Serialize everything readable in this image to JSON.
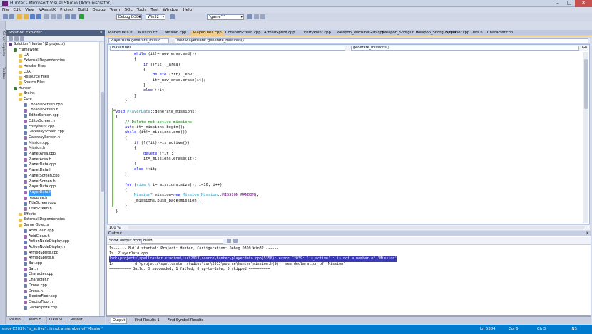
{
  "window": {
    "title": "Hunter - Microsoft Visual Studio (Administrator)",
    "min": "–",
    "max": "□",
    "close": "✕"
  },
  "menu": [
    "File",
    "Edit",
    "View",
    "VAssistX",
    "Project",
    "Build",
    "Debug",
    "Team",
    "SQL",
    "Tools",
    "Test",
    "Window",
    "Help"
  ],
  "menu_display": [
    "File",
    "Edit",
    "View",
    "VAssistX",
    "Project",
    "Build",
    "Debug",
    "TEAM",
    "SQL",
    "Tools",
    "Test",
    "Window",
    "Help"
  ],
  "toolbar": {
    "config": "Debug D3D9",
    "platform": "Win32",
    "find": "\"game\",\""
  },
  "solution_explorer": {
    "title": "Solution Explorer",
    "items": [
      {
        "label": "Solution 'Hunter' (2 projects)",
        "depth": 0,
        "type": "sol"
      },
      {
        "label": "Framework",
        "depth": 1,
        "type": "proj"
      },
      {
        "label": "DX",
        "depth": 2,
        "type": "folder"
      },
      {
        "label": "External Dependencies",
        "depth": 2,
        "type": "folder"
      },
      {
        "label": "Header Files",
        "depth": 2,
        "type": "folder"
      },
      {
        "label": "LUA",
        "depth": 2,
        "type": "folder"
      },
      {
        "label": "Resource Files",
        "depth": 2,
        "type": "folder"
      },
      {
        "label": "Source Files",
        "depth": 2,
        "type": "folder"
      },
      {
        "label": "Hunter",
        "depth": 1,
        "type": "proj"
      },
      {
        "label": "Brains",
        "depth": 2,
        "type": "folder"
      },
      {
        "label": "Core",
        "depth": 2,
        "type": "folder"
      },
      {
        "label": "ConsoleScreen.cpp",
        "depth": 3,
        "type": "cpp"
      },
      {
        "label": "ConsoleScreen.h",
        "depth": 3,
        "type": "h"
      },
      {
        "label": "EditorScreen.cpp",
        "depth": 3,
        "type": "cpp"
      },
      {
        "label": "EditorScreen.h",
        "depth": 3,
        "type": "h"
      },
      {
        "label": "EntryPoint.cpp",
        "depth": 3,
        "type": "cpp"
      },
      {
        "label": "GatewayScreen.cpp",
        "depth": 3,
        "type": "cpp"
      },
      {
        "label": "GatewayScreen.h",
        "depth": 3,
        "type": "h"
      },
      {
        "label": "Mission.cpp",
        "depth": 3,
        "type": "cpp"
      },
      {
        "label": "Mission.h",
        "depth": 3,
        "type": "h"
      },
      {
        "label": "PlanetArea.cpp",
        "depth": 3,
        "type": "cpp"
      },
      {
        "label": "PlanetArea.h",
        "depth": 3,
        "type": "h"
      },
      {
        "label": "PlanetData.cpp",
        "depth": 3,
        "type": "cpp"
      },
      {
        "label": "PlanetData.h",
        "depth": 3,
        "type": "h"
      },
      {
        "label": "PlanetScreen.cpp",
        "depth": 3,
        "type": "cpp"
      },
      {
        "label": "PlanetScreen.h",
        "depth": 3,
        "type": "h"
      },
      {
        "label": "PlayerData.cpp",
        "depth": 3,
        "type": "cpp"
      },
      {
        "label": "PlayerData.h",
        "depth": 3,
        "type": "h",
        "selected": true
      },
      {
        "label": "resource.h",
        "depth": 3,
        "type": "h"
      },
      {
        "label": "TitleScreen.cpp",
        "depth": 3,
        "type": "cpp"
      },
      {
        "label": "TitleScreen.h",
        "depth": 3,
        "type": "h"
      },
      {
        "label": "Effects",
        "depth": 2,
        "type": "folder"
      },
      {
        "label": "External Dependencies",
        "depth": 2,
        "type": "folder"
      },
      {
        "label": "Game Objects",
        "depth": 2,
        "type": "folder"
      },
      {
        "label": "AcidCloud.cpp",
        "depth": 3,
        "type": "cpp"
      },
      {
        "label": "AcidCloud.h",
        "depth": 3,
        "type": "h"
      },
      {
        "label": "ActionNodeDisplay.cpp",
        "depth": 3,
        "type": "cpp"
      },
      {
        "label": "ActionNodeDisplay.h",
        "depth": 3,
        "type": "h"
      },
      {
        "label": "ArmedSprite.cpp",
        "depth": 3,
        "type": "cpp"
      },
      {
        "label": "ArmedSprite.h",
        "depth": 3,
        "type": "h"
      },
      {
        "label": "Bat.cpp",
        "depth": 3,
        "type": "cpp"
      },
      {
        "label": "Bat.h",
        "depth": 3,
        "type": "h"
      },
      {
        "label": "Character.cpp",
        "depth": 3,
        "type": "cpp"
      },
      {
        "label": "Character.h",
        "depth": 3,
        "type": "h"
      },
      {
        "label": "Drone.cpp",
        "depth": 3,
        "type": "cpp"
      },
      {
        "label": "Drone.h",
        "depth": 3,
        "type": "h"
      },
      {
        "label": "ElectroFloor.cpp",
        "depth": 3,
        "type": "cpp"
      },
      {
        "label": "ElectroFloor.h",
        "depth": 3,
        "type": "h"
      },
      {
        "label": "GameSprite.cpp",
        "depth": 3,
        "type": "cpp"
      }
    ],
    "bottom_tabs": [
      "Solutio...",
      "Team E...",
      "Class Vi...",
      "Resour..."
    ]
  },
  "left_strip": [
    "Server Explorer",
    "Toolbox"
  ],
  "doc_tabs": [
    "PlanetData.h",
    "Mission.h*",
    "Mission.cpp",
    "PlayerData.cpp",
    "ConsoleScreen.cpp",
    "ArmedSprite.cpp",
    "EntryPoint.cpp",
    "Weapon_MachineGun.cpp",
    "Weapon_Shotgun.h",
    "Weapon_Shotgun.cpp",
    "Spawner.cpp",
    "Defs.h",
    "Character.cpp"
  ],
  "active_doc_tab": 3,
  "nav": {
    "file": "PlayerData.generate_missio",
    "scope": "void PlayerData::generate_missions()",
    "class": "PlayerData",
    "member": "generate_missions()",
    "go": "Go"
  },
  "code_lines": [
    [
      [
        "        ",
        ""
      ],
      [
        "while",
        "kw"
      ],
      [
        " (it!=_new_envs.end())",
        ""
      ]
    ],
    [
      [
        "        {",
        ""
      ]
    ],
    [
      [
        "            ",
        ""
      ],
      [
        "if",
        "kw"
      ],
      [
        " ((*it)._area)",
        ""
      ]
    ],
    [
      [
        "            {",
        ""
      ]
    ],
    [
      [
        "                ",
        ""
      ],
      [
        "delete",
        "kw"
      ],
      [
        " (*it)._env;",
        ""
      ]
    ],
    [
      [
        "                it=_new_envs.erase(it);",
        ""
      ]
    ],
    [
      [
        "            }",
        ""
      ]
    ],
    [
      [
        "            ",
        ""
      ],
      [
        "else",
        "kw"
      ],
      [
        " ++it;",
        ""
      ]
    ],
    [
      [
        "        }",
        ""
      ]
    ],
    [
      [
        "    }",
        ""
      ]
    ],
    [
      [
        "",
        ""
      ]
    ],
    [
      [
        "void",
        "kw"
      ],
      [
        " ",
        ""
      ],
      [
        "PlayerData",
        "ty"
      ],
      [
        "::generate_missions()",
        ""
      ]
    ],
    [
      [
        "{",
        ""
      ]
    ],
    [
      [
        "    ",
        ""
      ],
      [
        "// Delete not active missions",
        "cm"
      ]
    ],
    [
      [
        "    ",
        ""
      ],
      [
        "auto",
        "kw"
      ],
      [
        " it=_missions.begin();",
        ""
      ]
    ],
    [
      [
        "    ",
        ""
      ],
      [
        "while",
        "kw"
      ],
      [
        " (it!=_missions.end())",
        ""
      ]
    ],
    [
      [
        "    {",
        ""
      ]
    ],
    [
      [
        "        ",
        ""
      ],
      [
        "if",
        "kw"
      ],
      [
        " (!(*it)->is_active())",
        ""
      ]
    ],
    [
      [
        "        {",
        ""
      ]
    ],
    [
      [
        "            ",
        ""
      ],
      [
        "delete",
        "kw"
      ],
      [
        " (*it);",
        ""
      ]
    ],
    [
      [
        "            it=_missions.erase(it);",
        ""
      ]
    ],
    [
      [
        "        }",
        ""
      ]
    ],
    [
      [
        "        ",
        ""
      ],
      [
        "else",
        "kw"
      ],
      [
        " ++it;",
        ""
      ]
    ],
    [
      [
        "    }",
        ""
      ]
    ],
    [
      [
        "",
        ""
      ]
    ],
    [
      [
        "    ",
        ""
      ],
      [
        "for",
        "kw"
      ],
      [
        " (",
        ""
      ],
      [
        "size_t",
        "ty"
      ],
      [
        " i=_missions.size(); i<10; i++)",
        ""
      ]
    ],
    [
      [
        "    {",
        ""
      ]
    ],
    [
      [
        "        ",
        ""
      ],
      [
        "Mission",
        "ty"
      ],
      [
        "* mission=",
        ""
      ],
      [
        "new",
        "kw"
      ],
      [
        " ",
        ""
      ],
      [
        "Mission",
        "ty"
      ],
      [
        "(",
        ""
      ],
      [
        "Mission",
        "ty"
      ],
      [
        "::",
        ""
      ],
      [
        "MISSION_RANDOM",
        "mc"
      ],
      [
        ");",
        ""
      ]
    ],
    [
      [
        "        _missions.push_back(mission);",
        ""
      ]
    ],
    [
      [
        "    }",
        ""
      ]
    ],
    [
      [
        "}",
        ""
      ]
    ]
  ],
  "editor": {
    "zoom": "100 %"
  },
  "output": {
    "title": "Output",
    "show_label": "Show output from:",
    "source": "Build",
    "lines": [
      "1>------ Build started: Project: Hunter, Configuration: Debug D3D9 Win32 ------",
      "1>  PlayerData.cpp",
      "1>d:\\projects\\spellcaster studios\\isr\\2013\\source\\hunter\\playerdata.cpp(5358): error C2039: 'is_active' : is not a member of 'Mission'",
      "1>          d:\\projects\\spellcaster studios\\isr\\2013\\source\\hunter\\mission.h(9) : see declaration of 'Mission'",
      "========== Build: 0 succeeded, 1 failed, 0 up-to-date, 0 skipped =========="
    ],
    "highlight_line": 2,
    "tabs": [
      "Output",
      "Find Results 1",
      "Find Symbol Results"
    ]
  },
  "status": {
    "message": "error C2039: 'is_active' : is not a member of 'Mission'",
    "ln": "Ln 5384",
    "col": "Col 6",
    "ch": "Ch 3",
    "ins": "INS"
  },
  "colors": {
    "statusbar": "#007acc",
    "active_tab": "#f5cc84",
    "keyword": "#0000ff",
    "comment": "#008000",
    "type": "#2b91af",
    "macro": "#6f008a"
  }
}
